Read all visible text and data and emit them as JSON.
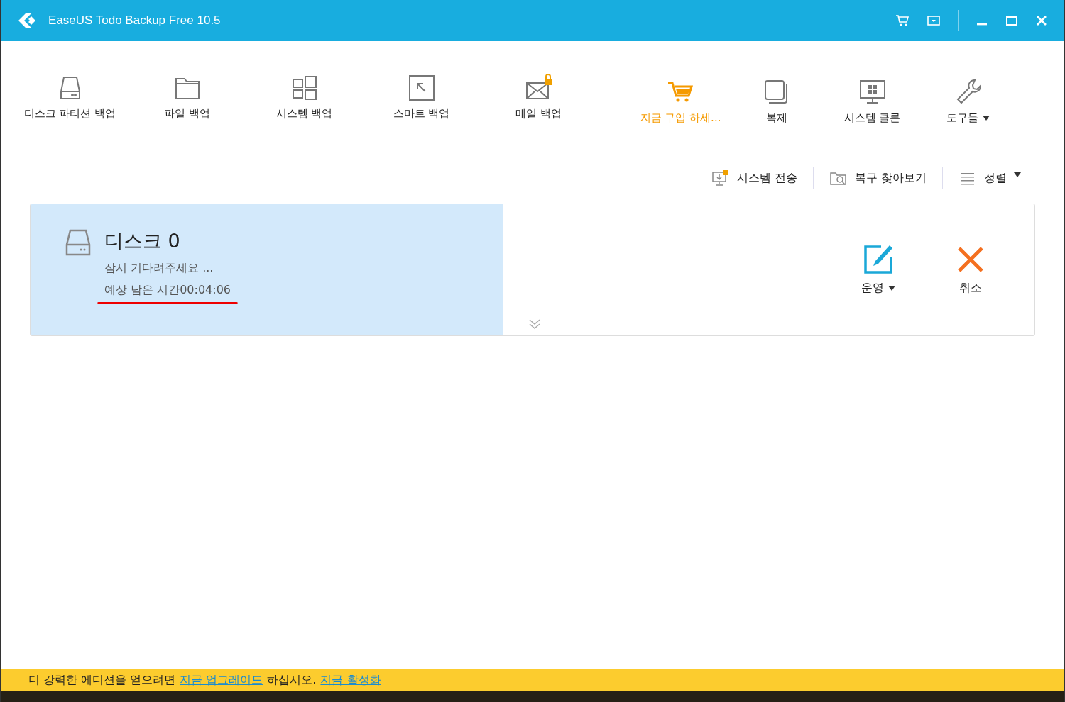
{
  "window": {
    "title": "EaseUS Todo Backup Free 10.5"
  },
  "toolbar": [
    {
      "label": "디스크 파티션 백업",
      "kind": "tool",
      "dropdown": false
    },
    {
      "label": "파일 백업",
      "kind": "tool",
      "dropdown": false
    },
    {
      "label": "시스템 백업",
      "kind": "tool",
      "dropdown": false
    },
    {
      "label": "스마트 백업",
      "kind": "tool",
      "dropdown": false
    },
    {
      "label": "메일 백업",
      "kind": "tool",
      "dropdown": false
    },
    {
      "label": "지금 구입 하세...",
      "kind": "promo",
      "dropdown": false
    },
    {
      "label": "복제",
      "kind": "tool",
      "dropdown": false
    },
    {
      "label": "시스템 클론",
      "kind": "tool",
      "dropdown": false
    },
    {
      "label": "도구들",
      "kind": "tool",
      "dropdown": true
    }
  ],
  "actions": [
    {
      "label": "시스템 전송",
      "dropdown": false
    },
    {
      "label": "복구 찾아보기",
      "dropdown": false
    },
    {
      "label": "정렬",
      "dropdown": true
    }
  ],
  "task": {
    "title": "디스크 0",
    "status": "잠시 기다려주세요 ...",
    "remaining": "예상 남은 시간00:04:06",
    "level": 0.47,
    "buttons": [
      {
        "label": "운영",
        "dropdown": true
      },
      {
        "label": "취소",
        "dropdown": false
      }
    ]
  },
  "banner": {
    "text": "더 강력한 에디션을 얻으려면",
    "link": "지금 업그레이드",
    "text2": "하십시오.",
    "link2": "지금 활성화"
  }
}
